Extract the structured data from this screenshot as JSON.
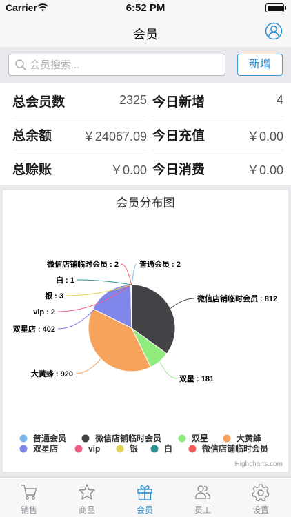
{
  "status_bar": {
    "carrier": "Carrier",
    "time": "6:52 PM"
  },
  "nav": {
    "title": "会员",
    "user_icon": "user-icon"
  },
  "search": {
    "placeholder": "会员搜索...",
    "value": "",
    "add_label": "新增"
  },
  "stats": [
    {
      "label": "总会员数",
      "value": "2325"
    },
    {
      "label": "今日新增",
      "value": "4"
    },
    {
      "label": "总余额",
      "value": "￥24067.09"
    },
    {
      "label": "今日充值",
      "value": "￥0.00"
    },
    {
      "label": "总赊账",
      "value": "￥0.00"
    },
    {
      "label": "今日消费",
      "value": "￥0.00"
    }
  ],
  "chart_data": {
    "type": "pie",
    "title": "会员分布图",
    "credit": "Highcharts.com",
    "slices": [
      {
        "name": "普通会员",
        "value": 2,
        "color": "#7cb5ec"
      },
      {
        "name": "微信店铺临时会员",
        "value": 812,
        "color": "#434348"
      },
      {
        "name": "双星",
        "value": 181,
        "color": "#90ed7d"
      },
      {
        "name": "大黄蜂",
        "value": 920,
        "color": "#f7a35c"
      },
      {
        "name": "双星店",
        "value": 402,
        "color": "#8085e9"
      },
      {
        "name": "vip",
        "value": 2,
        "color": "#f15c80"
      },
      {
        "name": "银",
        "value": 3,
        "color": "#e4d354"
      },
      {
        "name": "白",
        "value": 1,
        "color": "#2b908f"
      },
      {
        "name": "微信店铺临时会员",
        "value": 2,
        "color": "#f45b5b"
      }
    ],
    "legend": "bottom"
  },
  "tabs": [
    {
      "label": "销售",
      "icon": "cart-icon",
      "active": false
    },
    {
      "label": "商品",
      "icon": "star-icon",
      "active": false
    },
    {
      "label": "会员",
      "icon": "gift-icon",
      "active": true
    },
    {
      "label": "员工",
      "icon": "people-icon",
      "active": false
    },
    {
      "label": "设置",
      "icon": "gear-icon",
      "active": false
    }
  ],
  "colors": {
    "accent": "#2a8ed0",
    "inactive": "#8e8e93"
  }
}
